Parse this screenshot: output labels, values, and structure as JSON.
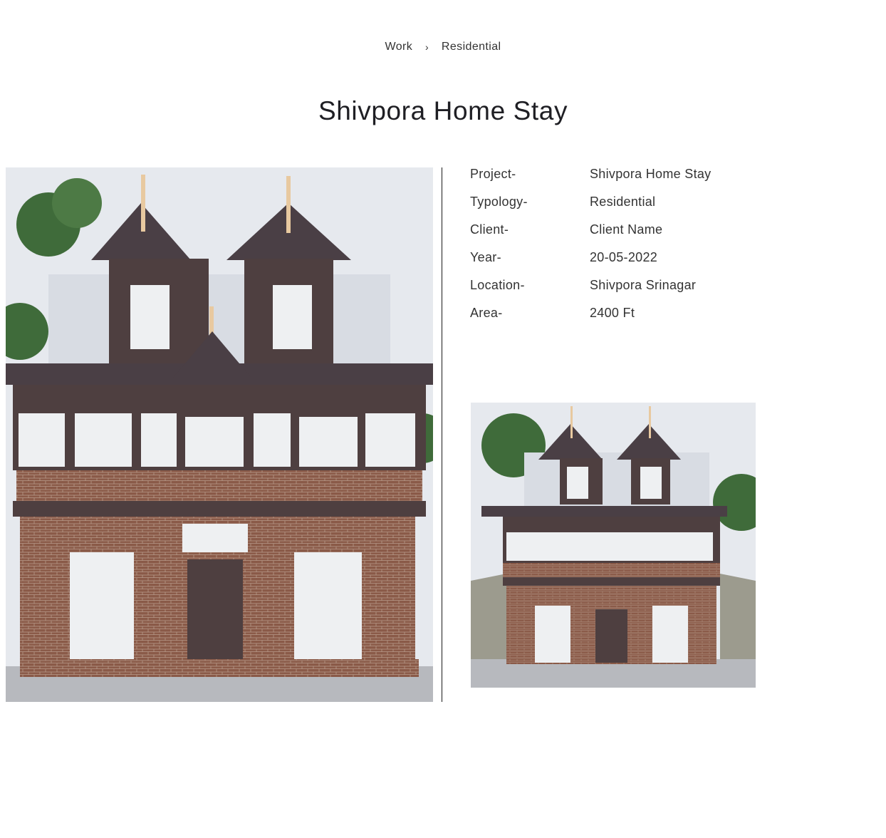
{
  "breadcrumb": {
    "items": [
      "Work",
      "Residential"
    ],
    "separator": "›"
  },
  "page": {
    "title": "Shivpora Home Stay"
  },
  "details": [
    {
      "label": "Project-",
      "value": "Shivpora Home Stay"
    },
    {
      "label": "Typology-",
      "value": "Residential"
    },
    {
      "label": "Client-",
      "value": "Client Name"
    },
    {
      "label": "Year-",
      "value": "20-05-2022"
    },
    {
      "label": "Location-",
      "value": "Shivpora Srinagar"
    },
    {
      "label": "Area-",
      "value": "2400 Ft"
    }
  ],
  "colors": {
    "sky": "#e6e9ee",
    "roof": "#4a3f45",
    "brick": "#8a5a48",
    "timber": "#4e3f40",
    "wall": "#d8dce3",
    "glass": "#eef0f2",
    "tree": "#3f6b3a",
    "finial": "#e8c9a0"
  }
}
